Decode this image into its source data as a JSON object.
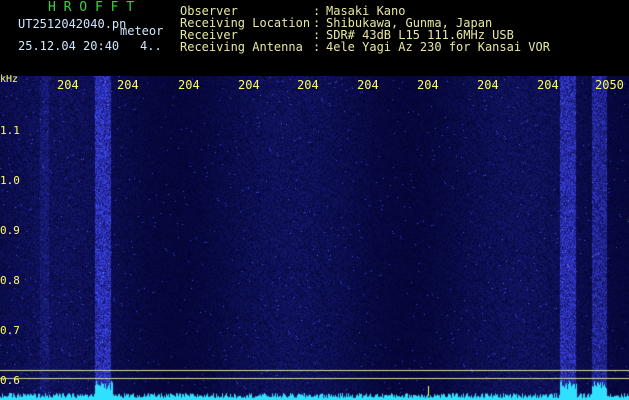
{
  "header": {
    "app_title": "H R O F F T",
    "filename": "UT2512042040.pn",
    "filename_suffix": "meteor",
    "datetime": "25.12.04 20:40",
    "page_indicator": "4..",
    "fields": [
      {
        "label": "Observer",
        "sep": ":",
        "value": "Masaki Kano"
      },
      {
        "label": "Receiving Location",
        "sep": ":",
        "value": "Shibukawa, Gunma, Japan"
      },
      {
        "label": "Receiver",
        "sep": ":",
        "value": "SDR# 43dB L15 111.6MHz USB"
      },
      {
        "label": "Receiving Antenna",
        "sep": ":",
        "value": "4ele Yagi Az 230 for Kansai VOR"
      }
    ]
  },
  "x_axis": {
    "ticks": [
      "204",
      "204",
      "204",
      "204",
      "204",
      "204",
      "204",
      "204",
      "204",
      "2050"
    ]
  },
  "y_axis": {
    "unit": "kHz",
    "ticks": [
      "1.1",
      "1.0",
      "0.9",
      "0.8",
      "0.7",
      "0.6"
    ]
  },
  "colors": {
    "background": "#000000",
    "header_text": "#e8e8a0",
    "title_green": "#3cd23c",
    "tick_yellow": "#ffff60",
    "spectrum_blue": "#1a1a7a",
    "baseline_cyan": "#30e0ff"
  }
}
